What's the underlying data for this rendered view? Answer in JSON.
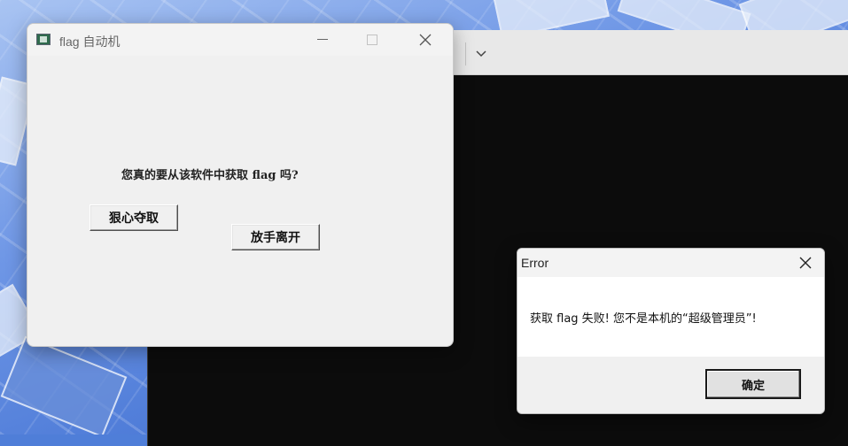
{
  "desktop": {},
  "terminal": {
    "dropdown_icon": "chevron-down-icon"
  },
  "flag_window": {
    "title": "flag 自动机",
    "icon": "app-window-icon",
    "controls": {
      "minimize": "—",
      "close": "✕"
    },
    "prompt": "您真的要从该软件中获取 flag 吗?",
    "seize_button": "狠心夺取",
    "leave_button": "放手离开"
  },
  "error_dialog": {
    "title": "Error",
    "close": "✕",
    "message": "获取 flag 失败! 您不是本机的“超级管理员”!",
    "ok_button": "确定"
  },
  "colors": {
    "terminal_bg": "#0c0c0c",
    "window_bg": "#f0f0f0",
    "dialog_body": "#ffffff"
  }
}
